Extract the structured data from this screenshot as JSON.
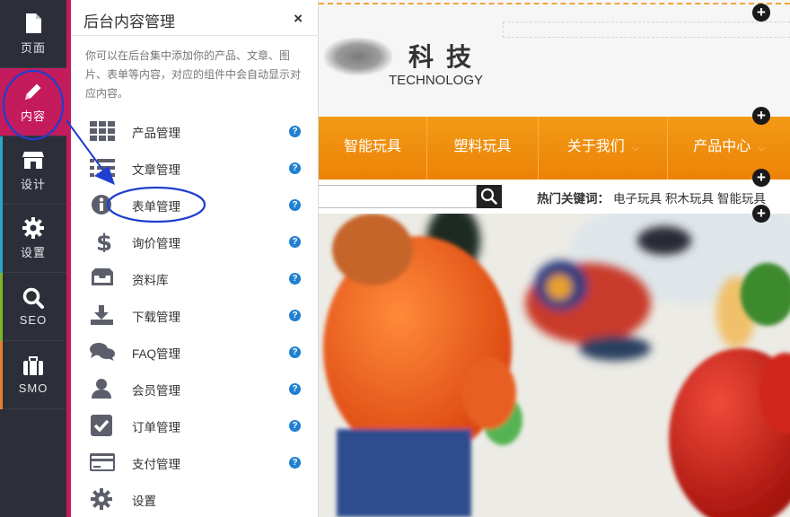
{
  "rail": {
    "items": [
      {
        "label": "页面",
        "icon": "file-icon"
      },
      {
        "label": "内容",
        "icon": "pencil-icon",
        "active": true
      },
      {
        "label": "设计",
        "icon": "storefront-icon"
      },
      {
        "label": "设置",
        "icon": "gear-icon"
      },
      {
        "label": "SEO",
        "icon": "search-icon"
      },
      {
        "label": "SMO",
        "icon": "briefcase-icon"
      }
    ],
    "accent": "#c41b5c"
  },
  "panel": {
    "title": "后台内容管理",
    "close": "×",
    "description": "你可以在后台集中添加你的产品、文章、图片、表单等内容，对应的组件中会自动显示对应内容。",
    "items": [
      {
        "label": "产品管理",
        "icon": "grid-icon",
        "help": "?"
      },
      {
        "label": "文章管理",
        "icon": "list-icon",
        "help": "?"
      },
      {
        "label": "表单管理",
        "icon": "info-icon",
        "help": "?"
      },
      {
        "label": "询价管理",
        "icon": "dollar-icon",
        "help": "?"
      },
      {
        "label": "资料库",
        "icon": "inbox-icon",
        "help": "?"
      },
      {
        "label": "下载管理",
        "icon": "download-icon",
        "help": "?"
      },
      {
        "label": "FAQ管理",
        "icon": "chat-icon",
        "help": "?"
      },
      {
        "label": "会员管理",
        "icon": "user-icon",
        "help": "?"
      },
      {
        "label": "订单管理",
        "icon": "checkbox-icon",
        "help": "?"
      },
      {
        "label": "支付管理",
        "icon": "credit-card-icon",
        "help": "?"
      },
      {
        "label": "设置",
        "icon": "gear-icon"
      }
    ]
  },
  "site": {
    "brand": "科技",
    "brand_sub": "TECHNOLOGY",
    "nav": [
      "智能玩具",
      "塑料玩具",
      "关于我们",
      "产品中心"
    ],
    "hot_label": "热门关键词：",
    "hot_keywords": [
      "电子玩具",
      "积木玩具",
      "智能玩具"
    ],
    "add_button": "+",
    "nav_color": "#f0900f"
  }
}
